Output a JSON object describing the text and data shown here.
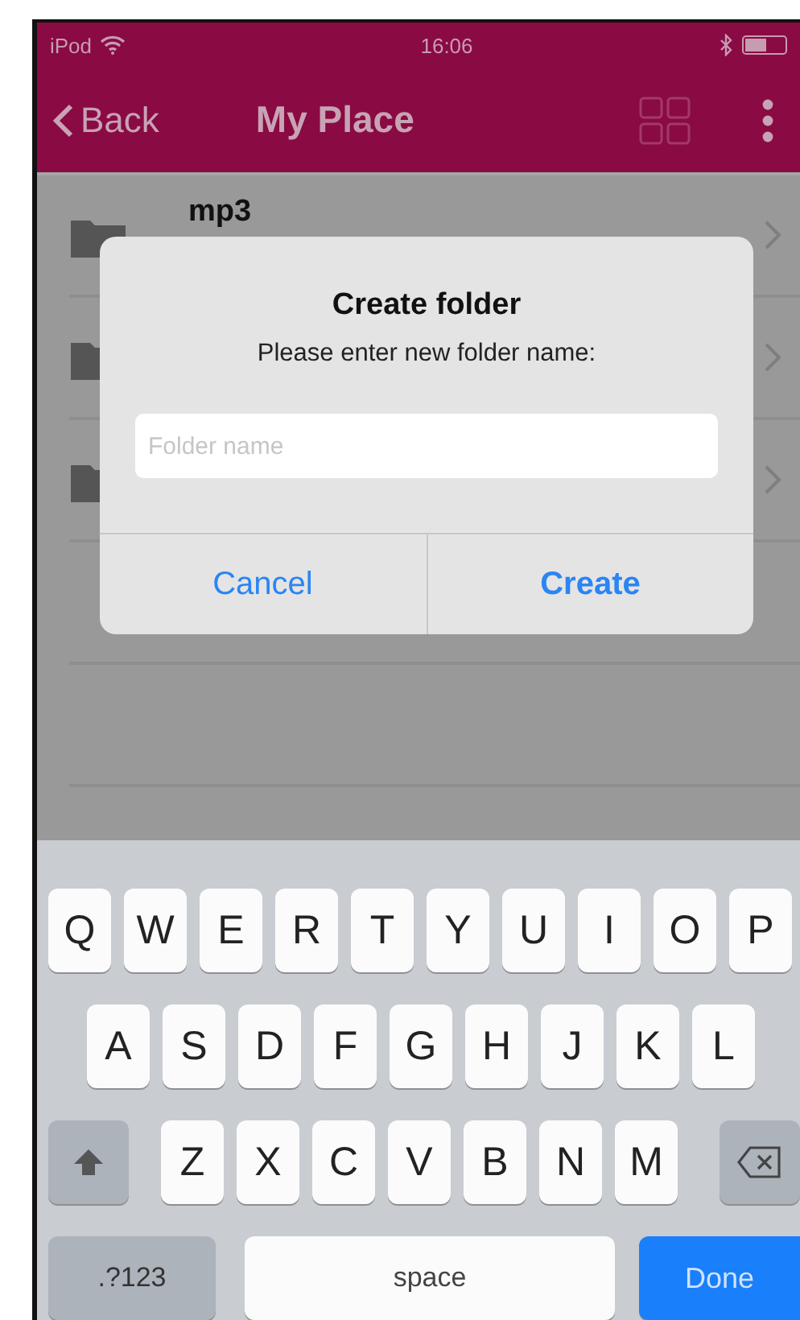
{
  "status_bar": {
    "carrier": "iPod",
    "time": "16:06"
  },
  "nav": {
    "back": "Back",
    "title": "My Place"
  },
  "rows": [
    {
      "kind": "folder",
      "name": "mp3"
    },
    {
      "kind": "folder"
    },
    {
      "kind": "folder"
    },
    {
      "kind": "empty"
    },
    {
      "kind": "empty"
    }
  ],
  "dialog": {
    "title": "Create folder",
    "message": "Please enter new folder name:",
    "placeholder": "Folder name",
    "buttons": [
      "Cancel",
      "Create"
    ]
  },
  "keyboard": {
    "rows": [
      [
        "Q",
        "W",
        "E",
        "R",
        "T",
        "Y",
        "U",
        "I",
        "O",
        "P"
      ],
      [
        "A",
        "S",
        "D",
        "F",
        "G",
        "H",
        "J",
        "K",
        "L"
      ],
      [
        "Z",
        "X",
        "C",
        "V",
        "B",
        "N",
        "M"
      ]
    ],
    "numbers_key": ".?123",
    "space_key": "space",
    "done_key": "Done"
  }
}
